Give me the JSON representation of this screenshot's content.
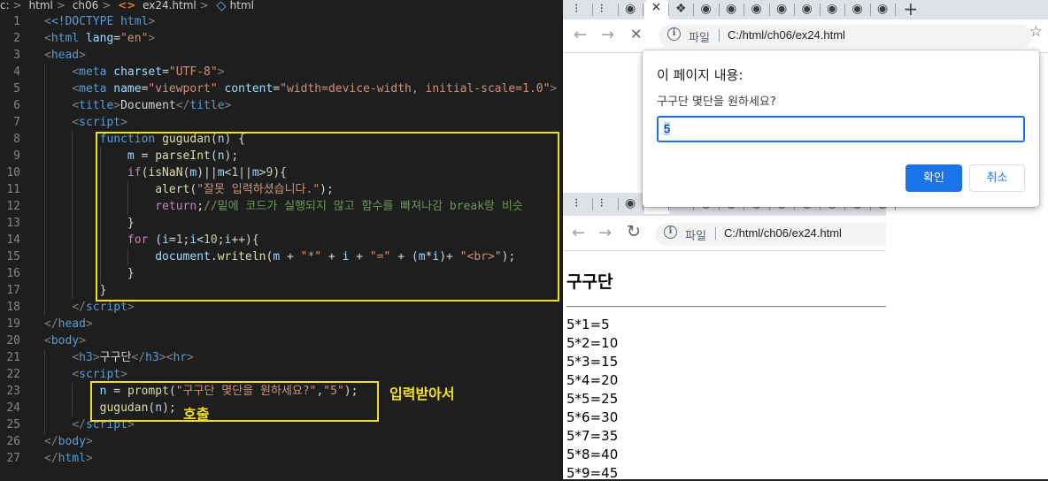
{
  "breadcrumb": {
    "parts": [
      "c:",
      "html",
      "ch06",
      "ex24.html",
      "html"
    ]
  },
  "code": {
    "line_numbers": [
      "1",
      "2",
      "3",
      "4",
      "5",
      "6",
      "7",
      "8",
      "9",
      "10",
      "11",
      "12",
      "13",
      "14",
      "15",
      "16",
      "17",
      "18",
      "19",
      "20",
      "21",
      "22",
      "23",
      "24",
      "25",
      "26",
      "27"
    ],
    "t": {
      "doctype": "<!DOCTYPE",
      "html": "html",
      "lang": "lang",
      "lang_val": "\"en\"",
      "head": "head",
      "meta": "meta",
      "charset": "charset",
      "charset_val": "\"UTF-8\"",
      "name": "name",
      "viewport": "\"viewport\"",
      "content": "content",
      "content_val": "\"width=device-width, initial-scale=1.0\"",
      "title": "title",
      "title_text": "Document",
      "script": "script",
      "function": "function",
      "gugudan": "gugudan",
      "n": "n",
      "m": "m",
      "parseInt": "parseInt",
      "if": "if",
      "isNaN": "isNaN",
      "alert": "alert",
      "alert_msg": "\"잘못 입력하셨습니다.\"",
      "return": "return",
      "comment": "//밑에 코드가 실행되지 않고 함수를 빠져나감 break랑 비슷",
      "for": "for",
      "i": "i",
      "document": "document",
      "writeln": "writeln",
      "star": "\"*\"",
      "eq": "\"=\"",
      "br_str": "\"<br>\"",
      "num0": "0",
      "num1": "1",
      "num9": "9",
      "num10": "10",
      "body": "body",
      "h3": "h3",
      "h3_text": "구구단",
      "hr": "hr",
      "prompt": "prompt",
      "prompt_msg": "\"구구단 몇단을 원하세요?\"",
      "prompt_default": "\"5\""
    }
  },
  "annotations": {
    "input_note": "입력받아서",
    "call_note": "호출"
  },
  "browser1": {
    "file_label": "파일",
    "url": "C:/html/ch06/ex24.html",
    "dialog": {
      "title": "이 페이지 내용:",
      "message": "구구단 몇단을 원하세요?",
      "input_value": "5",
      "ok_label": "확인",
      "cancel_label": "취소"
    }
  },
  "browser2": {
    "file_label": "파일",
    "url": "C:/html/ch06/ex24.html",
    "heading": "구구단",
    "results": [
      "5*1=5",
      "5*2=10",
      "5*3=15",
      "5*4=20",
      "5*5=25",
      "5*6=30",
      "5*7=35",
      "5*8=40",
      "5*9=45"
    ]
  },
  "icons": {
    "tab_close": "×",
    "new_tab": "+",
    "back": "←",
    "forward": "→",
    "stop": "✕",
    "reload": "↻",
    "info": "i",
    "star": "☆"
  },
  "colors": {
    "highlight_box": "#f5e11b",
    "dialog_accent": "#1a73e8"
  }
}
